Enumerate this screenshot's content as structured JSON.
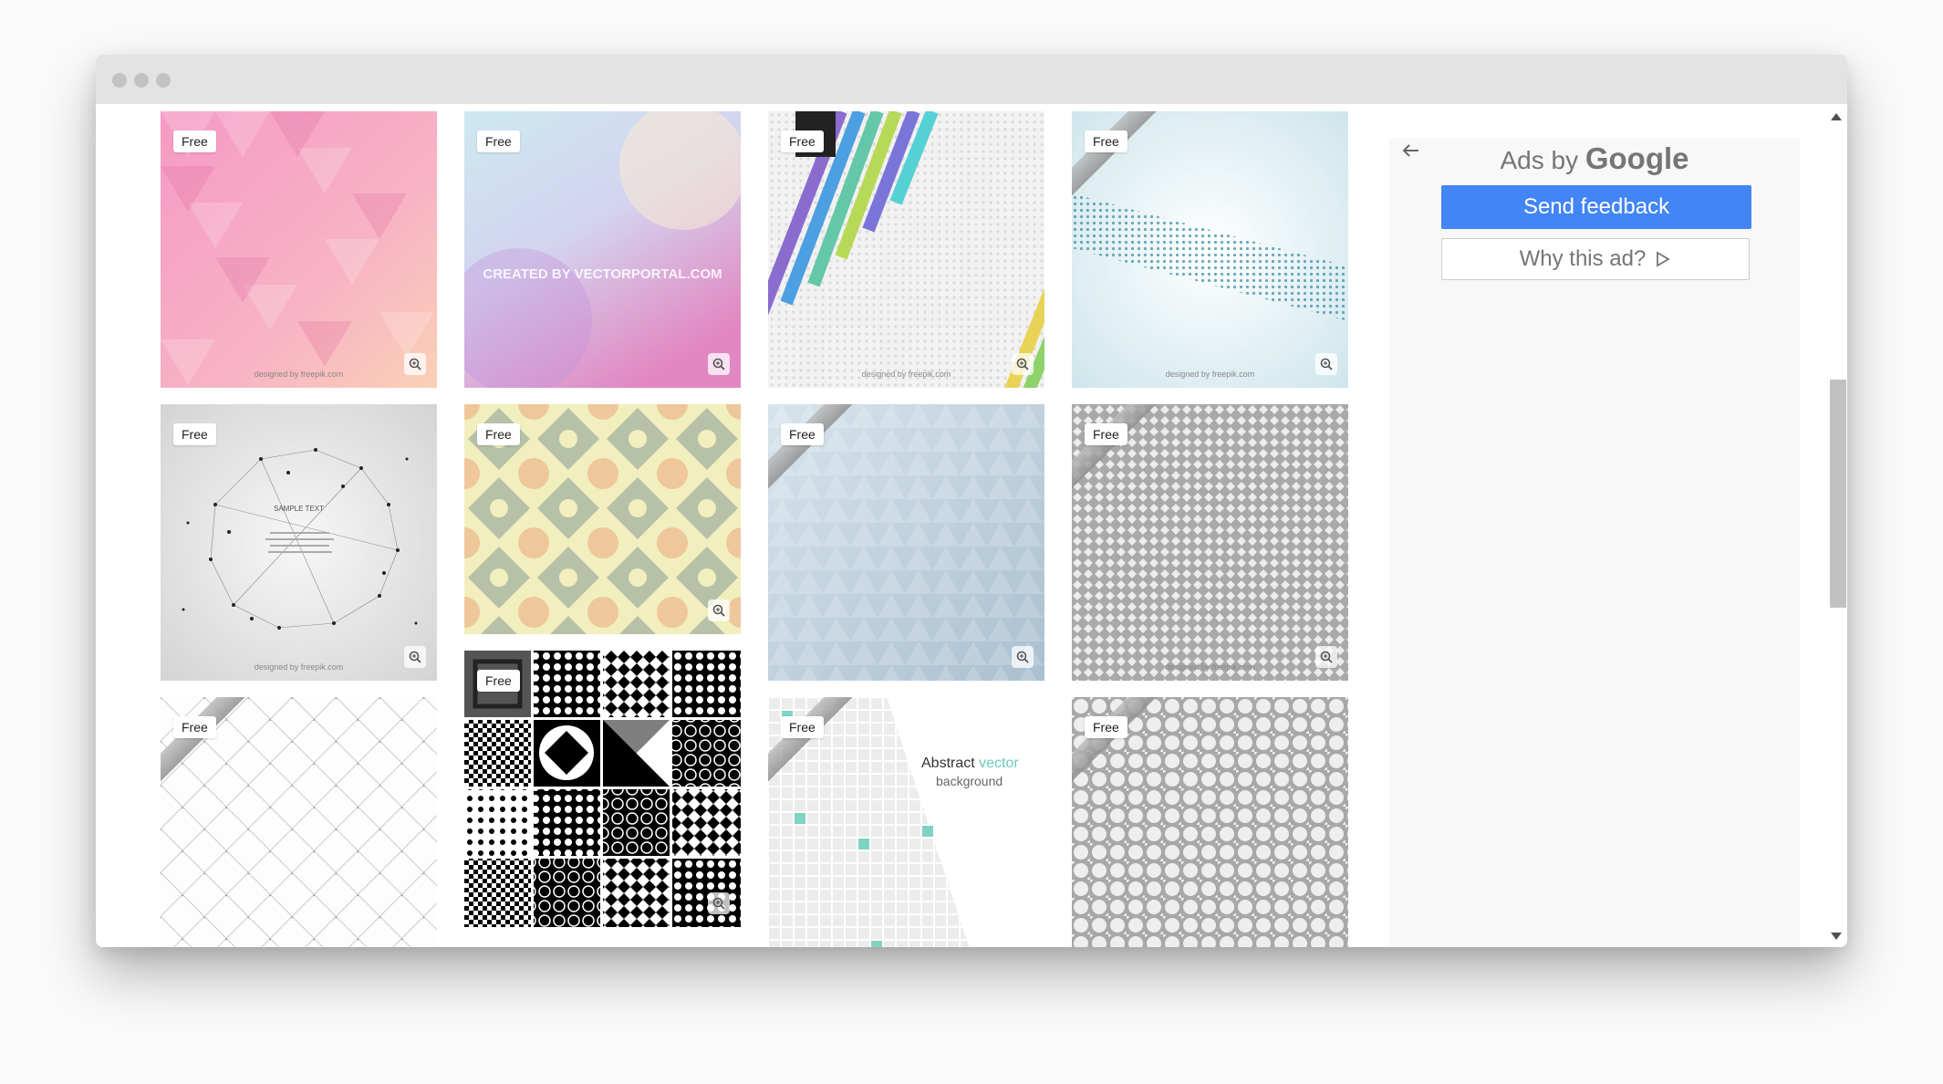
{
  "gallery": {
    "badge_label": "Free",
    "tiles": [
      {
        "name": "pink-geometric-triangles",
        "badge": "Free",
        "credit": "designed by freepik.com"
      },
      {
        "name": "pastel-blur-gradient",
        "badge": "Free",
        "watermark": "CREATED BY VECTORPORTAL.COM"
      },
      {
        "name": "rainbow-diagonal-stripes",
        "badge": "Free",
        "credit": "designed by freepik.com"
      },
      {
        "name": "teal-halftone-band",
        "badge": "Free",
        "credit": "designed by freepik.com"
      },
      {
        "name": "polygon-network",
        "badge": "Free",
        "sample_text": "SAMPLE TEXT",
        "credit": "designed by freepik.com"
      },
      {
        "name": "floral-tile-pattern",
        "badge": "Free"
      },
      {
        "name": "blue-triangle-mosaic",
        "badge": "Free"
      },
      {
        "name": "grey-diamond-lattice",
        "badge": "Free",
        "credit": "designed by freepik.com"
      },
      {
        "name": "dotted-grid-pattern",
        "badge": "Free"
      },
      {
        "name": "black-white-patterns",
        "badge": "Free"
      },
      {
        "name": "abstract-squares",
        "badge": "Free",
        "title_main": "Abstract",
        "title_accent": "vector",
        "subtitle": "background"
      },
      {
        "name": "grey-circle-pattern",
        "badge": "Free"
      }
    ]
  },
  "ads": {
    "ads_by_prefix": "Ads by",
    "ads_by_brand": "Google",
    "send_feedback": "Send feedback",
    "why_this_ad": "Why this ad?"
  },
  "colors": {
    "accent": "#4285f4",
    "titlebar": "#e3e3e3"
  }
}
